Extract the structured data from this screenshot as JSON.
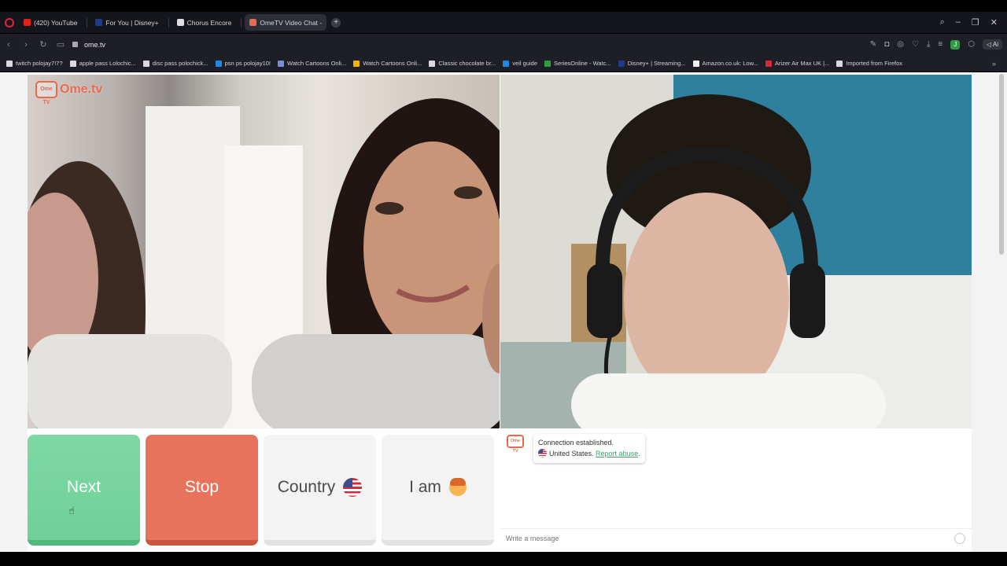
{
  "browser": {
    "tabs": [
      {
        "label": "(420) YouTube",
        "icon": "youtube-icon",
        "color": "#e62117"
      },
      {
        "label": "For You | Disney+",
        "icon": "disney-icon",
        "color": "#1d3b8a"
      },
      {
        "label": "Chorus Encore",
        "icon": "chorus-icon",
        "color": "#dddddd"
      },
      {
        "label": "OmeTV Video Chat -",
        "icon": "ometv-icon",
        "color": "#e66a4e",
        "active": true
      }
    ],
    "url": "ome.tv",
    "bookmarks": [
      {
        "label": "twitch polojay7!7?",
        "color": "#d9d9de"
      },
      {
        "label": "apple pass Lolochic...",
        "color": "#d9d9de"
      },
      {
        "label": "disc pass polochick...",
        "color": "#d9d9de"
      },
      {
        "label": "psn ps polojay10!",
        "color": "#1e88e5"
      },
      {
        "label": "Watch Cartoons Onli...",
        "color": "#7b8cd1"
      },
      {
        "label": "Watch Cartoons Onli...",
        "color": "#f0b400"
      },
      {
        "label": "Classic chocolate br...",
        "color": "#d9d9de"
      },
      {
        "label": "veil guide",
        "color": "#1e88e5"
      },
      {
        "label": "SeriesOnline - Watc...",
        "color": "#2e9b45"
      },
      {
        "label": "Disney+ | Streaming...",
        "color": "#1d3b8a"
      },
      {
        "label": "Amazon.co.uk: Low...",
        "color": "#f2f2f2"
      },
      {
        "label": "Arizer Air Max UK |...",
        "color": "#d62a3b"
      },
      {
        "label": "Imported from Firefox",
        "color": "#d9d9de"
      }
    ],
    "ai_label": "Ai",
    "ext_label": "J",
    "more_glyph": "»"
  },
  "video": {
    "logo_text": "Ome.tv",
    "logo_box": "Ome TV"
  },
  "controls": {
    "next_label": "Next",
    "stop_label": "Stop",
    "country_label": "Country",
    "iam_label": "I am"
  },
  "chat": {
    "logo_box": "Ome TV",
    "status_line": "Connection established.",
    "country": "United States.",
    "report_label": "Report abuse",
    "report_suffix": ".",
    "input_placeholder": "Write a message"
  },
  "colors": {
    "next_green": "#7ed8a3",
    "stop_red": "#e8735c",
    "brand_orange": "#e66a4e"
  }
}
